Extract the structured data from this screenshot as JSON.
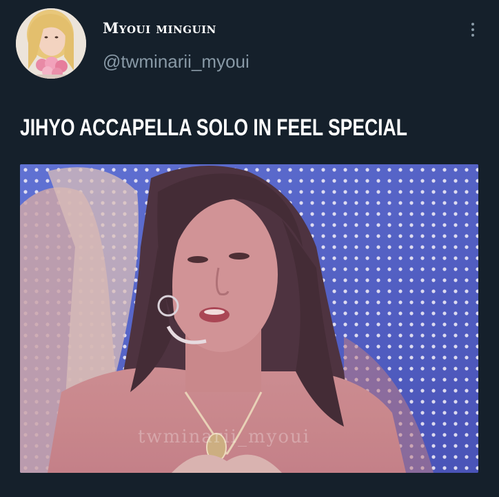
{
  "tweet": {
    "author": {
      "display_name": "Myoui minguin",
      "handle": "@twminarii_myoui"
    },
    "text": "JIHYO ACCAPELLA SOLO IN FEEL SPECIAL",
    "emoji_icon": "heart-with-ribbon-emoji",
    "media": {
      "kind": "video-still",
      "watermark": "twminarii_myoui"
    }
  },
  "colors": {
    "background": "#15202b",
    "primary_text": "#ffffff",
    "secondary_text": "#8899a6"
  }
}
